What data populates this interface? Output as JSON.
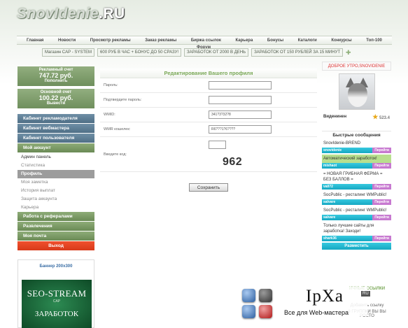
{
  "brand": {
    "name": "SnovIdenie",
    "tld": ".RU"
  },
  "nav": [
    "Главная",
    "Новости",
    "Просмотр рекламы",
    "Заказ рекламы",
    "Биржа ссылок",
    "Карьера",
    "Бонусы",
    "Каталоги",
    "Конкурсы",
    "Топ-100"
  ],
  "nav_extra": "Форум",
  "ticker": [
    "Магазин CAP - SYSTEM",
    "600 РУБ В ЧАС + БОНУС ДО 50 СРАЗУ!",
    "ЗАРАБОТОК ОТ 2000 В ДЕНЬ",
    "ЗАРАБОТОК ОТ 150 РУБЛЕЙ ЗА 15 МИНУТ"
  ],
  "accounts": [
    {
      "title": "Рекламный счет",
      "value": "747.72 руб.",
      "action": "Пополнить"
    },
    {
      "title": "Основной счет",
      "value": "100.22 руб.",
      "action": "Вывести"
    }
  ],
  "menu": {
    "advertiser": "Кабинет рекламодателя",
    "webmaster": "Кабинет вебмастера",
    "user": "Кабинет пользователя",
    "account": "Мой аккаунт",
    "account_items": [
      "Админ панель",
      "Статистика",
      "Профиль",
      "Моя заметка",
      "История выплат",
      "Защита аккаунта",
      "Карьера"
    ],
    "referrals": "Работа с рефералами",
    "fun": "Развлечения",
    "mail": "Моя почта",
    "logout": "Выход"
  },
  "banner": {
    "title": "Баннер 200х300",
    "line1": "SEO-STREAM",
    "line2": "CAP",
    "line3": "ЗАРАБОТОК"
  },
  "form": {
    "title": "Редактирование Вашего профиля",
    "fields": [
      {
        "label": "Пароль:",
        "value": ""
      },
      {
        "label": "Подтвердите пароль:",
        "value": ""
      },
      {
        "label": "WMID:",
        "value": "341?3?32?8"
      },
      {
        "label": "WMR кошелек:",
        "value": "R6???1?6????"
      }
    ],
    "captcha_label": "Введите код:",
    "captcha_value": "",
    "captcha_code": "962",
    "save": "Сохранить"
  },
  "user": {
    "greeting": "ДОБРОЕ УТРО,SNOVIDENIE",
    "name": "Виденинен",
    "score": "523.4"
  },
  "quick": {
    "title": "Быстрые сообщения",
    "messages": [
      {
        "text": "SnovIdenie-BREND",
        "user": "snovidenie",
        "highlight": false
      },
      {
        "text": "Автоматический заработок!",
        "user": "mishaot",
        "highlight": true
      },
      {
        "text": "= НОВАЯ ГРИБНАЯ ФЕРМА = БЕЗ БАЛЛОВ =",
        "user": "vall72",
        "highlight": false
      },
      {
        "text": "SocPublic - ресталинг WMPublic!",
        "user": "salvare",
        "highlight": false
      },
      {
        "text": "SocPublic - ресталинг WMPublic!",
        "user": "salvare",
        "highlight": false
      },
      {
        "text": "Только лучшие сайты для заработка! Заходи!",
        "user": "shark36",
        "highlight": false
      }
    ],
    "reply": "Перейти",
    "post": "Разместить"
  },
  "links": {
    "title": "ИЧНЫЕ ССЫЛКИ",
    "add": "Добавить ссылку",
    "more": "ё ГРУППКИ ВЫ ВЫ РОСТО"
  },
  "watermark": {
    "big": "IpXa",
    "ru": "RU",
    "caption": "Все для Web-мастера"
  }
}
